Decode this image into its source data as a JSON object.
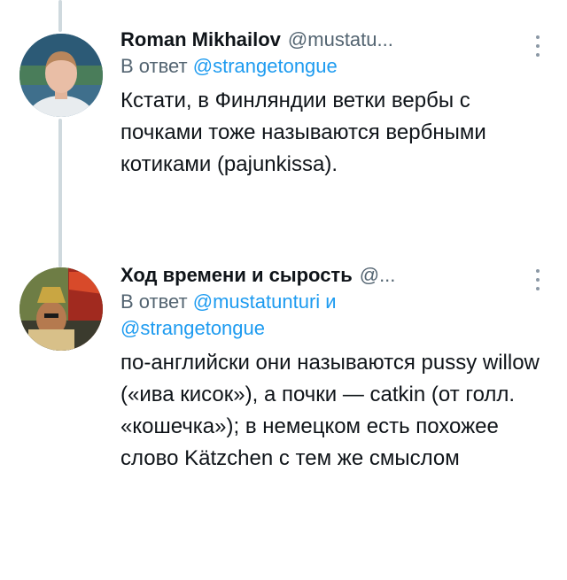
{
  "tweets": [
    {
      "name": "Roman Mikhailov",
      "handle": "@mustatu...",
      "reply_prefix": "В ответ",
      "reply_mentions": [
        "@strangetongue"
      ],
      "reply_joiner": "",
      "text": "Кстати, в Финляндии ветки вербы с почками тоже называются вербными котиками (pajunkissa)."
    },
    {
      "name": "Ход времени и сырость",
      "handle": "@...",
      "reply_prefix": "В ответ",
      "reply_mentions": [
        "@mustatunturi",
        "@strangetongue"
      ],
      "reply_joiner": "и",
      "text": "по-английски они называются pussy willow («ива кисок»), а почки — catkin (от голл. «кошечка»); в немецком есть похожее слово Kätzchen с тем же смыслом"
    }
  ],
  "icons": {
    "more": "more-vertical-icon",
    "avatar": "avatar"
  },
  "colors": {
    "text": "#0f1419",
    "secondary": "#536471",
    "link": "#1d9bf0",
    "thread_line": "#cfd9de"
  }
}
